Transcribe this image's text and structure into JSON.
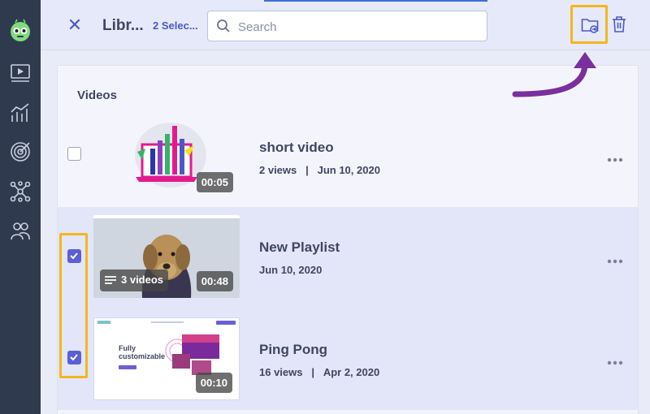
{
  "header": {
    "title": "Libr...",
    "selected_label": "2 Selec...",
    "search_placeholder": "Search",
    "close_symbol": "✕"
  },
  "library": {
    "section_title": "Videos",
    "items": [
      {
        "title": "short video",
        "views": "2 views",
        "separator": "|",
        "date": "Jun 10, 2020",
        "duration": "00:05",
        "checked": false
      },
      {
        "title": "New Playlist",
        "date": "Jun 10, 2020",
        "playlist_count": "3 videos",
        "duration": "00:48",
        "checked": true
      },
      {
        "title": "Ping Pong",
        "views": "16 views",
        "separator": "|",
        "date": "Apr 2, 2020",
        "duration": "00:10",
        "checked": true
      }
    ]
  },
  "thumbnail_text": {
    "site_heading_line1": "Fully",
    "site_heading_line2": "customizable"
  },
  "colors": {
    "rail": "#2f3a4f",
    "accent": "#4b58c7",
    "checkbox_on": "#5b5fd6",
    "highlight": "#f2b71f",
    "arrow": "#7a2f9e"
  }
}
